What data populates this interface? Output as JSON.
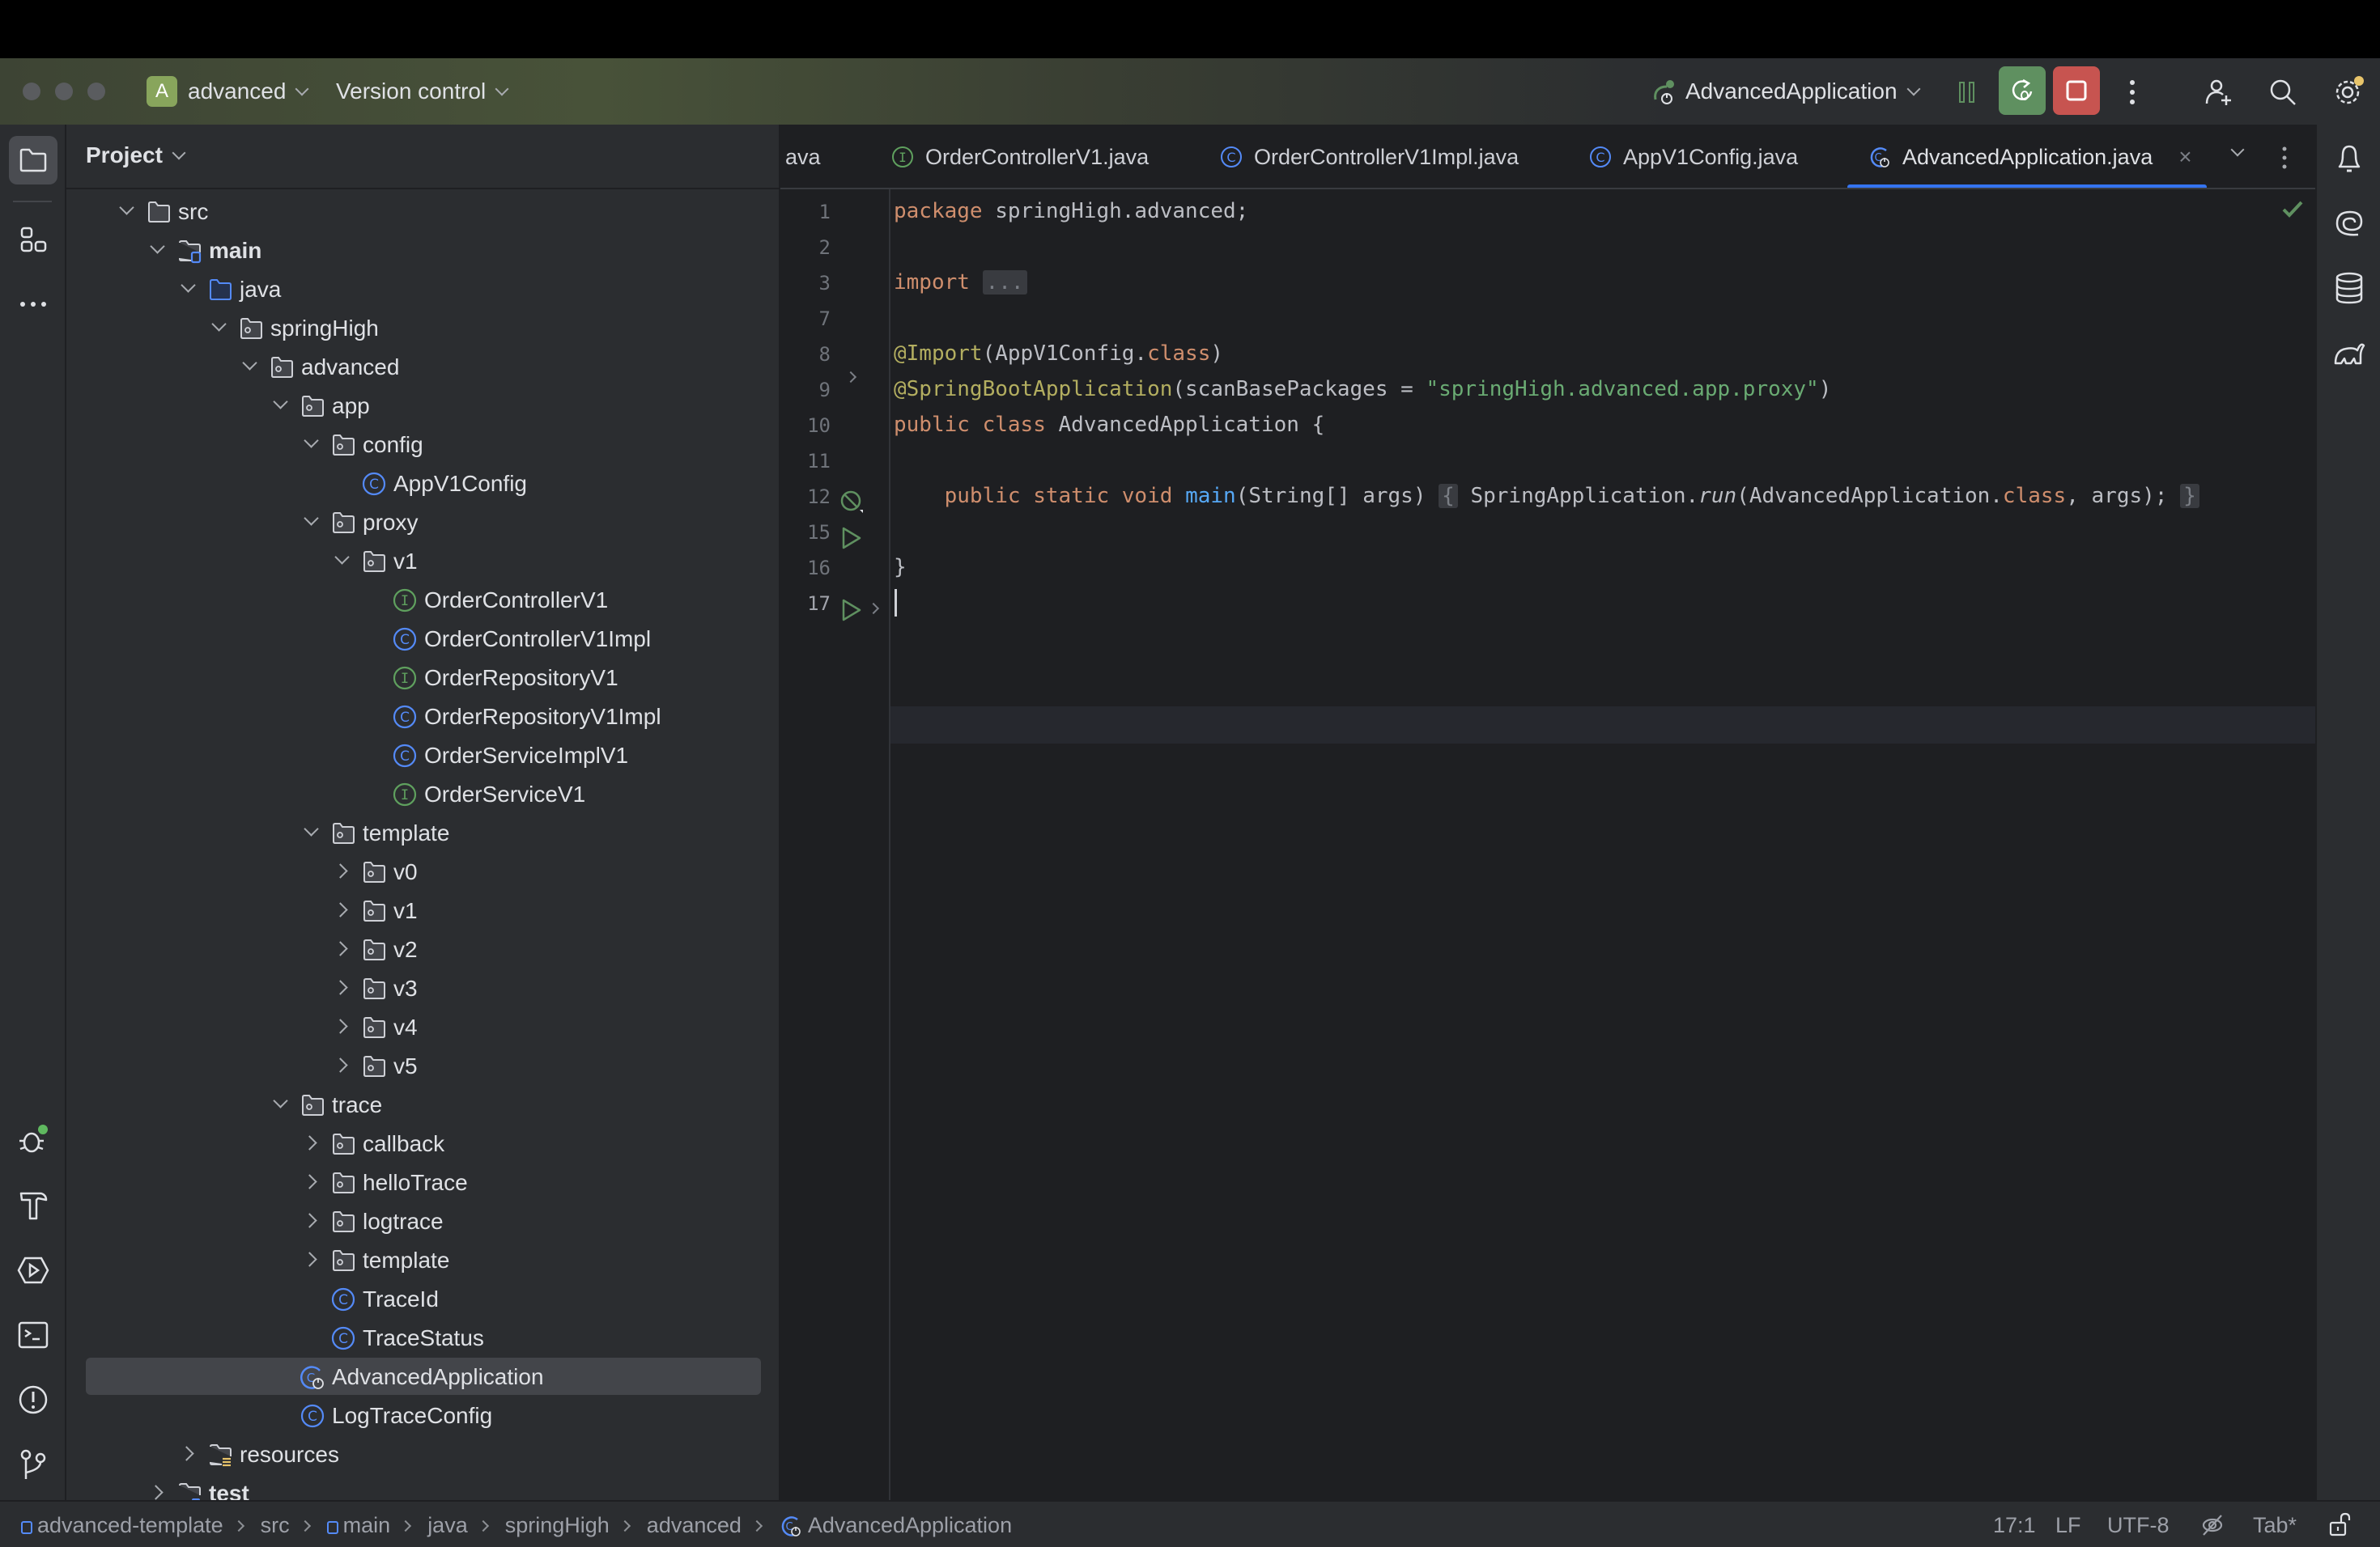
{
  "window": {
    "project_badge": "A",
    "project_name": "advanced",
    "vcs_label": "Version control",
    "run_config": "AdvancedApplication"
  },
  "colors": {
    "accent": "#3574f0",
    "debug_button": "#5f9060",
    "stop_button": "#c75450",
    "project_badge": "#88a55c",
    "interface_icon": "#5fa05e",
    "class_icon": "#548af7"
  },
  "left_strip": {
    "top_icons": [
      "folder-icon",
      "structure-icon",
      "more-icon"
    ],
    "bottom_icons": [
      "debug-icon",
      "build-icon",
      "services-icon",
      "terminal-icon",
      "problems-icon",
      "git-icon"
    ]
  },
  "project_panel": {
    "title": "Project",
    "tree": [
      {
        "label": "src",
        "depth": 0,
        "arrow": "down",
        "icon": "folder"
      },
      {
        "label": "main",
        "depth": 1,
        "arrow": "down",
        "icon": "module-folder",
        "bold": true
      },
      {
        "label": "java",
        "depth": 2,
        "arrow": "down",
        "icon": "source-folder"
      },
      {
        "label": "springHigh",
        "depth": 3,
        "arrow": "down",
        "icon": "package"
      },
      {
        "label": "advanced",
        "depth": 4,
        "arrow": "down",
        "icon": "package"
      },
      {
        "label": "app",
        "depth": 5,
        "arrow": "down",
        "icon": "package"
      },
      {
        "label": "config",
        "depth": 6,
        "arrow": "down",
        "icon": "package"
      },
      {
        "label": "AppV1Config",
        "depth": 7,
        "arrow": "none",
        "icon": "class"
      },
      {
        "label": "proxy",
        "depth": 6,
        "arrow": "down",
        "icon": "package"
      },
      {
        "label": "v1",
        "depth": 7,
        "arrow": "down",
        "icon": "package"
      },
      {
        "label": "OrderControllerV1",
        "depth": 8,
        "arrow": "none",
        "icon": "interface"
      },
      {
        "label": "OrderControllerV1Impl",
        "depth": 8,
        "arrow": "none",
        "icon": "class"
      },
      {
        "label": "OrderRepositoryV1",
        "depth": 8,
        "arrow": "none",
        "icon": "interface"
      },
      {
        "label": "OrderRepositoryV1Impl",
        "depth": 8,
        "arrow": "none",
        "icon": "class"
      },
      {
        "label": "OrderServiceImplV1",
        "depth": 8,
        "arrow": "none",
        "icon": "class"
      },
      {
        "label": "OrderServiceV1",
        "depth": 8,
        "arrow": "none",
        "icon": "interface"
      },
      {
        "label": "template",
        "depth": 6,
        "arrow": "down",
        "icon": "package"
      },
      {
        "label": "v0",
        "depth": 7,
        "arrow": "right",
        "icon": "package"
      },
      {
        "label": "v1",
        "depth": 7,
        "arrow": "right",
        "icon": "package"
      },
      {
        "label": "v2",
        "depth": 7,
        "arrow": "right",
        "icon": "package"
      },
      {
        "label": "v3",
        "depth": 7,
        "arrow": "right",
        "icon": "package"
      },
      {
        "label": "v4",
        "depth": 7,
        "arrow": "right",
        "icon": "package"
      },
      {
        "label": "v5",
        "depth": 7,
        "arrow": "right",
        "icon": "package"
      },
      {
        "label": "trace",
        "depth": 5,
        "arrow": "down",
        "icon": "package"
      },
      {
        "label": "callback",
        "depth": 6,
        "arrow": "right",
        "icon": "package"
      },
      {
        "label": "helloTrace",
        "depth": 6,
        "arrow": "right",
        "icon": "package"
      },
      {
        "label": "logtrace",
        "depth": 6,
        "arrow": "right",
        "icon": "package"
      },
      {
        "label": "template",
        "depth": 6,
        "arrow": "right",
        "icon": "package"
      },
      {
        "label": "TraceId",
        "depth": 6,
        "arrow": "none",
        "icon": "class"
      },
      {
        "label": "TraceStatus",
        "depth": 6,
        "arrow": "none",
        "icon": "class"
      },
      {
        "label": "AdvancedApplication",
        "depth": 5,
        "arrow": "none",
        "icon": "spring-class",
        "selected": true
      },
      {
        "label": "LogTraceConfig",
        "depth": 5,
        "arrow": "none",
        "icon": "class"
      },
      {
        "label": "resources",
        "depth": 2,
        "arrow": "right",
        "icon": "resources-folder"
      },
      {
        "label": "test",
        "depth": 1,
        "arrow": "right",
        "icon": "test-folder",
        "bold": true
      }
    ]
  },
  "editor": {
    "tabs": [
      {
        "label": "ava",
        "icon": "none"
      },
      {
        "label": "OrderControllerV1.java",
        "icon": "interface"
      },
      {
        "label": "OrderControllerV1Impl.java",
        "icon": "class"
      },
      {
        "label": "AppV1Config.java",
        "icon": "class"
      },
      {
        "label": "AdvancedApplication.java",
        "icon": "spring-class",
        "active": true
      }
    ],
    "close_label": "×",
    "line_numbers": [
      "1",
      "2",
      "3",
      "7",
      "8",
      "9",
      "10",
      "11",
      "12",
      "15",
      "16",
      "17"
    ],
    "lines": [
      [
        {
          "t": "package ",
          "c": "kw"
        },
        {
          "t": "springHigh.advanced;",
          "c": ""
        }
      ],
      [],
      [
        {
          "t": "import ",
          "c": "kw"
        },
        {
          "t": "...",
          "c": "fold"
        }
      ],
      [],
      [
        {
          "t": "@Import",
          "c": "ann"
        },
        {
          "t": "(AppV1Config.",
          "c": ""
        },
        {
          "t": "class",
          "c": "kw"
        },
        {
          "t": ")",
          "c": ""
        }
      ],
      [
        {
          "t": "@SpringBootApplication",
          "c": "ann"
        },
        {
          "t": "(scanBasePackages = ",
          "c": ""
        },
        {
          "t": "\"springHigh.advanced.app.proxy\"",
          "c": "str"
        },
        {
          "t": ")",
          "c": ""
        }
      ],
      [
        {
          "t": "public ",
          "c": "kw"
        },
        {
          "t": "class ",
          "c": "kw"
        },
        {
          "t": "AdvancedApplication {",
          "c": ""
        }
      ],
      [],
      [
        {
          "t": "    ",
          "c": ""
        },
        {
          "t": "public ",
          "c": "kw"
        },
        {
          "t": "static ",
          "c": "kw"
        },
        {
          "t": "void ",
          "c": "kw"
        },
        {
          "t": "main",
          "c": "fn"
        },
        {
          "t": "(String[] args) ",
          "c": ""
        },
        {
          "t": "{",
          "c": "fold"
        },
        {
          "t": " SpringApplication.",
          "c": ""
        },
        {
          "t": "run",
          "c": "it"
        },
        {
          "t": "(AdvancedApplication.",
          "c": ""
        },
        {
          "t": "class",
          "c": "kw"
        },
        {
          "t": ", args); ",
          "c": ""
        },
        {
          "t": "}",
          "c": "fold"
        }
      ],
      [],
      [
        {
          "t": "}",
          "c": ""
        }
      ],
      []
    ],
    "inspection_status": "no-problems"
  },
  "right_strip": {
    "icons": [
      "notifications-icon",
      "ai-assistant-icon",
      "database-icon",
      "gradle-icon"
    ]
  },
  "status_bar": {
    "breadcrumbs": [
      "advanced-template",
      "src",
      "main",
      "java",
      "springHigh",
      "advanced",
      "AdvancedApplication"
    ],
    "position": "17:1",
    "line_separator": "LF",
    "encoding": "UTF-8",
    "indent": "Tab*"
  }
}
